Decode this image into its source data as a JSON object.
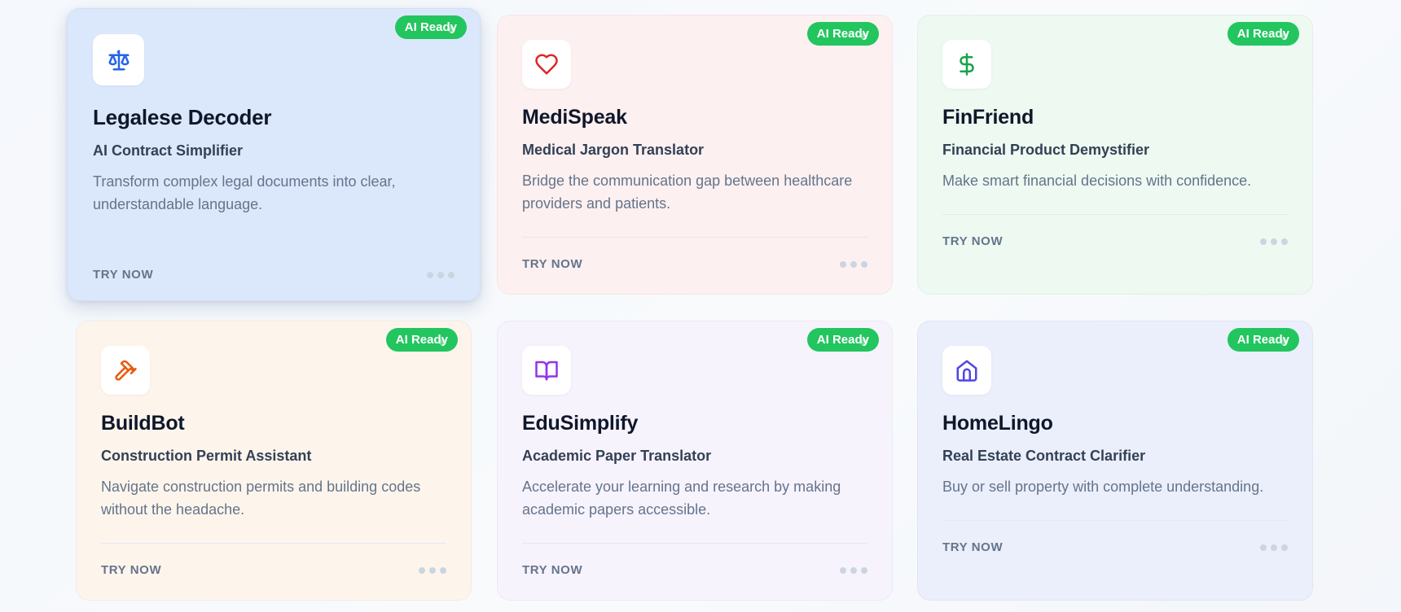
{
  "badge_label": "AI Ready",
  "cards": [
    {
      "title": "Legalese Decoder",
      "subtitle": "AI Contract Simplifier",
      "description": "Transform complex legal documents into clear, understandable language.",
      "cta": "TRY NOW",
      "icon": "scale-icon",
      "bg": "#dbe8fc",
      "accent": "#2563eb"
    },
    {
      "title": "MediSpeak",
      "subtitle": "Medical Jargon Translator",
      "description": "Bridge the communication gap between healthcare providers and patients.",
      "cta": "TRY NOW",
      "icon": "heart-icon",
      "bg": "#fdf0f0",
      "accent": "#dc2626"
    },
    {
      "title": "FinFriend",
      "subtitle": "Financial Product Demystifier",
      "description": "Make smart financial decisions with confidence.",
      "cta": "TRY NOW",
      "icon": "dollar-icon",
      "bg": "#edf9f1",
      "accent": "#16a34a"
    },
    {
      "title": "BuildBot",
      "subtitle": "Construction Permit Assistant",
      "description": "Navigate construction permits and building codes without the headache.",
      "cta": "TRY NOW",
      "icon": "hammer-icon",
      "bg": "#fdf5ec",
      "accent": "#ea580c"
    },
    {
      "title": "EduSimplify",
      "subtitle": "Academic Paper Translator",
      "description": "Accelerate your learning and research by making academic papers accessible.",
      "cta": "TRY NOW",
      "icon": "book-open-icon",
      "bg": "#f7f3fd",
      "accent": "#9333ea"
    },
    {
      "title": "HomeLingo",
      "subtitle": "Real Estate Contract Clarifier",
      "description": "Buy or sell property with complete understanding.",
      "cta": "TRY NOW",
      "icon": "home-icon",
      "bg": "#ebeffb",
      "accent": "#4f46e5"
    }
  ]
}
